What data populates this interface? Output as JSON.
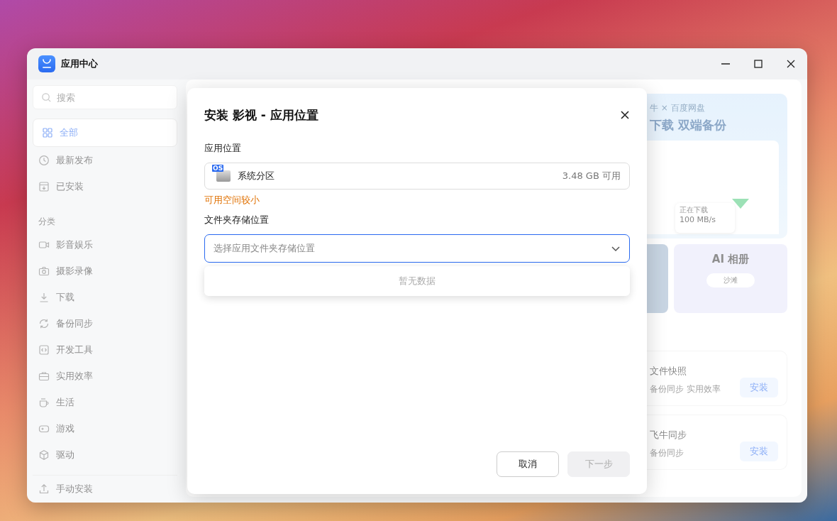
{
  "window": {
    "title": "应用中心"
  },
  "sidebar": {
    "search": {
      "placeholder": "搜索"
    },
    "items": [
      {
        "label": "全部",
        "selected": true
      },
      {
        "label": "最新发布",
        "selected": false
      },
      {
        "label": "已安装",
        "selected": false
      }
    ],
    "section_title": "分类",
    "categories": [
      {
        "label": "影音娱乐",
        "selected": false
      },
      {
        "label": "摄影录像",
        "selected": false
      },
      {
        "label": "下载",
        "selected": false
      },
      {
        "label": "备份同步",
        "selected": false
      },
      {
        "label": "开发工具",
        "selected": false
      },
      {
        "label": "实用效率",
        "selected": false
      },
      {
        "label": "生活",
        "selected": false
      },
      {
        "label": "游戏",
        "selected": false
      },
      {
        "label": "驱动",
        "selected": false
      }
    ],
    "footer": {
      "label": "手动安装"
    }
  },
  "banner": {
    "subtitle": "牛 × 百度网盘",
    "title": "下载 双端备份",
    "speed_caption": "正在下载",
    "speed": "100 MB/s"
  },
  "photo_tile": {
    "title": "AI 相册",
    "query": "沙滩"
  },
  "apps": [
    {
      "name": "文件快照",
      "tags": "备份同步 实用效率",
      "action": "安装"
    },
    {
      "name": "飞牛同步",
      "tags": "备份同步",
      "action": "安装"
    }
  ],
  "dialog": {
    "title": "安装 影视 - 应用位置",
    "location_label": "应用位置",
    "location": {
      "badge": "OS",
      "name": "系统分区",
      "free": "3.48 GB 可用"
    },
    "warning": "可用空间较小",
    "folder_label": "文件夹存储位置",
    "folder_select": {
      "placeholder": "选择应用文件夹存储位置",
      "expanded": true,
      "empty_text": "暂无数据"
    },
    "buttons": [
      {
        "label": "取消",
        "disabled": false
      },
      {
        "label": "下一步",
        "disabled": true
      }
    ]
  }
}
